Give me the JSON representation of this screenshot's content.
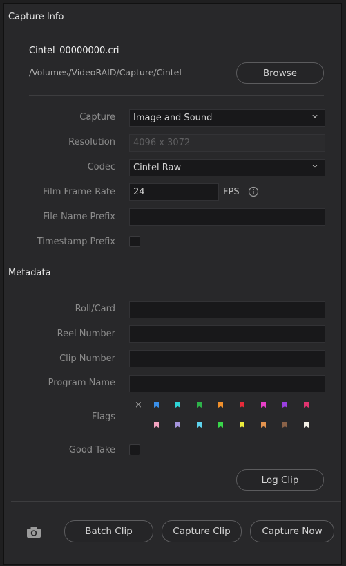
{
  "capture_info": {
    "section_title": "Capture Info",
    "file_name": "Cintel_00000000.cri",
    "path": "/Volumes/VideoRAID/Capture/Cintel",
    "browse_label": "Browse"
  },
  "fields": {
    "capture_label": "Capture",
    "capture_value": "Image and Sound",
    "resolution_label": "Resolution",
    "resolution_value": "4096 x 3072",
    "codec_label": "Codec",
    "codec_value": "Cintel Raw",
    "film_frame_rate_label": "Film Frame Rate",
    "film_frame_rate_value": "24",
    "fps_label": "FPS",
    "file_name_prefix_label": "File Name Prefix",
    "file_name_prefix_value": "",
    "timestamp_prefix_label": "Timestamp Prefix",
    "timestamp_prefix_checked": false
  },
  "metadata": {
    "section_title": "Metadata",
    "roll_card_label": "Roll/Card",
    "roll_card_value": "",
    "reel_number_label": "Reel Number",
    "reel_number_value": "",
    "clip_number_label": "Clip Number",
    "clip_number_value": "",
    "program_name_label": "Program Name",
    "program_name_value": "",
    "flags_label": "Flags",
    "flag_clear_symbol": "×",
    "flag_colors_row1": [
      "#3a8fe8",
      "#2ed4d6",
      "#2eb34a",
      "#f0902c",
      "#e82b3a",
      "#e83fc8",
      "#9b3fe0",
      "#e0346f"
    ],
    "flag_colors_row2": [
      "#f2a3bf",
      "#a695dd",
      "#5ed3ee",
      "#39d64a",
      "#ecec3c",
      "#e3934e",
      "#8a6248",
      "#f3f0e6"
    ],
    "good_take_label": "Good Take",
    "good_take_checked": false,
    "log_clip_label": "Log Clip"
  },
  "footer": {
    "camera_icon": "camera-icon",
    "batch_clip_label": "Batch Clip",
    "capture_clip_label": "Capture Clip",
    "capture_now_label": "Capture Now"
  }
}
